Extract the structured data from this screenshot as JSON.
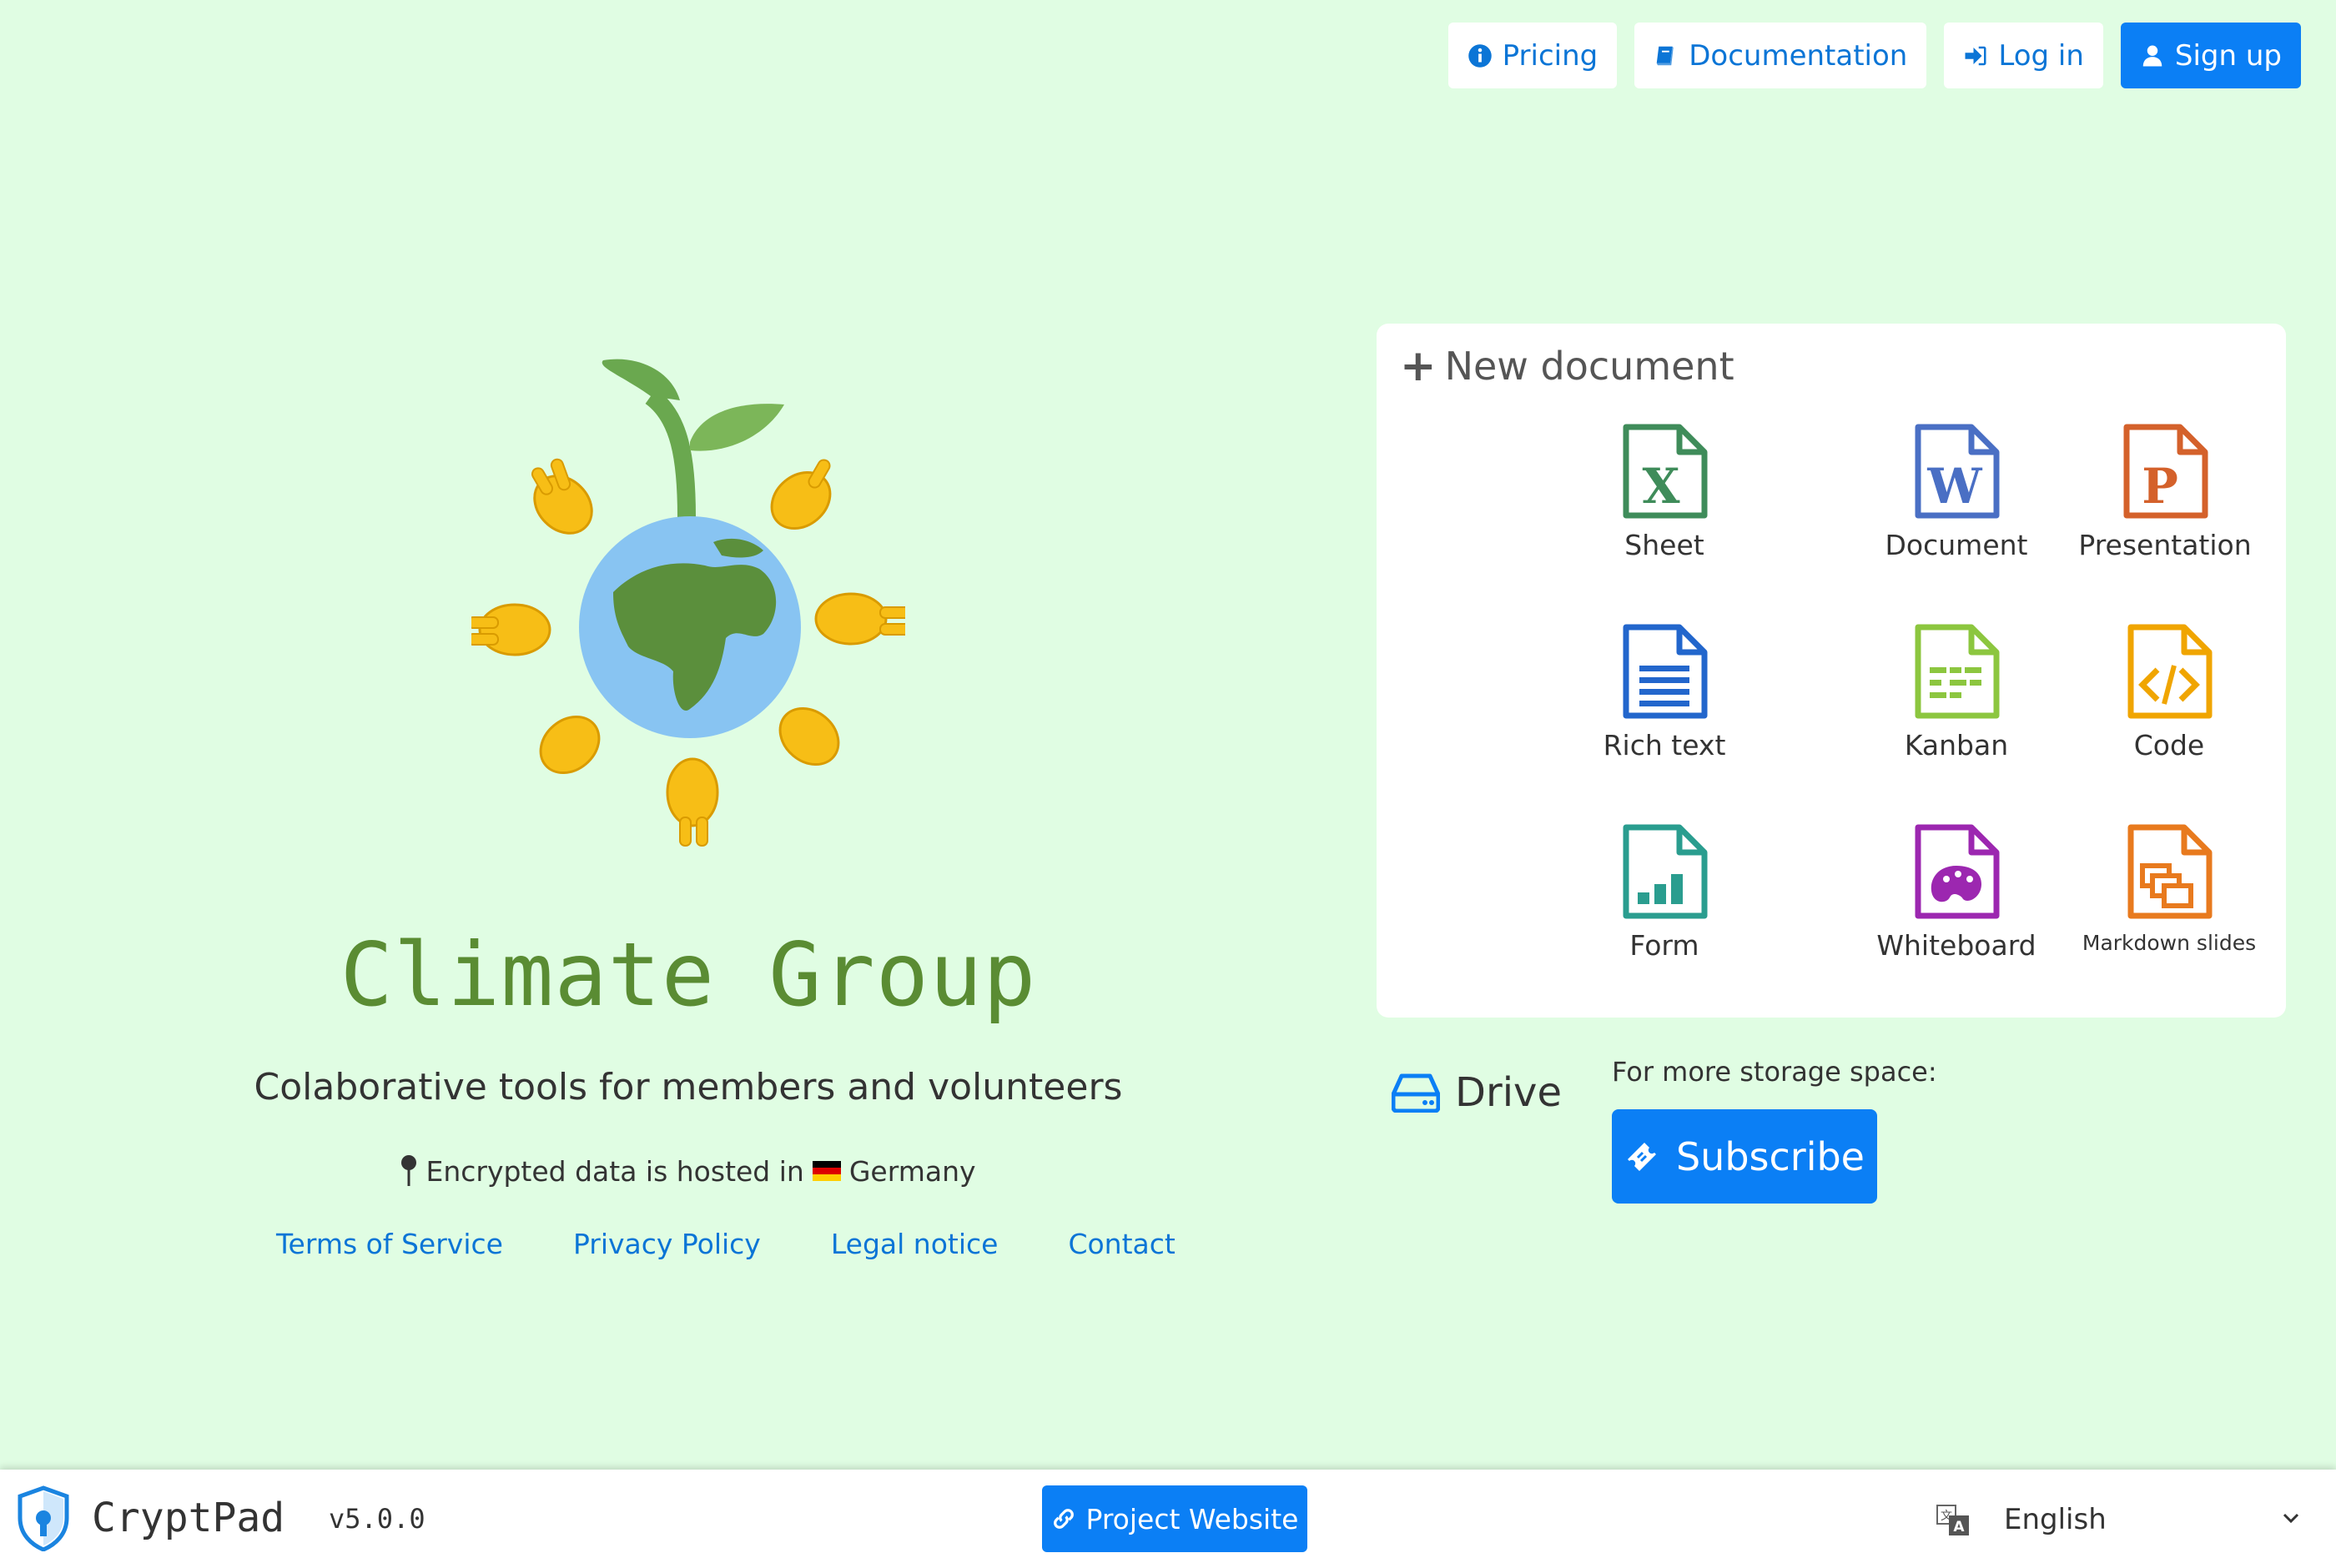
{
  "nav": {
    "pricing": "Pricing",
    "documentation": "Documentation",
    "login": "Log in",
    "signup": "Sign up"
  },
  "hero": {
    "title": "Climate Group",
    "tagline": "Colaborative tools for members and volunteers",
    "hosted_prefix": "Encrypted data is hosted in",
    "hosted_country": "Germany"
  },
  "links": {
    "terms": "Terms of Service",
    "privacy": "Privacy Policy",
    "legal": "Legal notice",
    "contact": "Contact"
  },
  "new_document": {
    "title": "New document",
    "items": [
      {
        "label": "Sheet",
        "icon": "sheet-icon",
        "color": "#3f8c5a"
      },
      {
        "label": "Document",
        "icon": "document-icon",
        "color": "#4a6fc4"
      },
      {
        "label": "Presentation",
        "icon": "presentation-icon",
        "color": "#d4612b"
      },
      {
        "label": "Rich text",
        "icon": "rich-text-icon",
        "color": "#2266cc"
      },
      {
        "label": "Kanban",
        "icon": "kanban-icon",
        "color": "#8cc63f"
      },
      {
        "label": "Code",
        "icon": "code-icon",
        "color": "#f0a500"
      },
      {
        "label": "Form",
        "icon": "form-icon",
        "color": "#2a9d8f"
      },
      {
        "label": "Whiteboard",
        "icon": "whiteboard-icon",
        "color": "#9c27b0"
      },
      {
        "label": "Markdown slides",
        "icon": "markdown-slides-icon",
        "color": "#e87a1e"
      }
    ]
  },
  "drive": {
    "label": "Drive"
  },
  "storage": {
    "label": "For more storage space:",
    "subscribe": "Subscribe"
  },
  "footer": {
    "brand": "CryptPad",
    "version": "v5.0.0",
    "project_website": "Project Website",
    "language": "English"
  },
  "colors": {
    "background": "#e0fde3",
    "accent": "#0b7ff5",
    "link": "#0b75d6",
    "title_green": "#5a8c33"
  }
}
